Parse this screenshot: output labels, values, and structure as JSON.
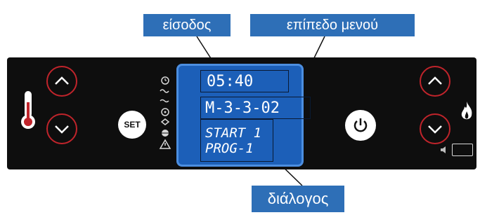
{
  "callouts": {
    "entry": "είσοδος",
    "menu_level": "επίπεδο μενού",
    "dialog": "διάλογος"
  },
  "panel": {
    "set_label": "SET",
    "display": {
      "time": "05:40",
      "menu_code": "M-3-3-02",
      "dialog_line1": "START 1",
      "dialog_line2": "PROG-1"
    }
  },
  "colors": {
    "callout": "#2e6fb7",
    "panel": "#0e0e0e",
    "lcd": "#1c5fb8",
    "button_ring": "#c0242b"
  },
  "icons": [
    "thermometer-icon",
    "arrow-up-icon",
    "arrow-down-icon",
    "clock-icon",
    "warning-icon",
    "power-icon",
    "flame-icon",
    "speaker-icon"
  ]
}
